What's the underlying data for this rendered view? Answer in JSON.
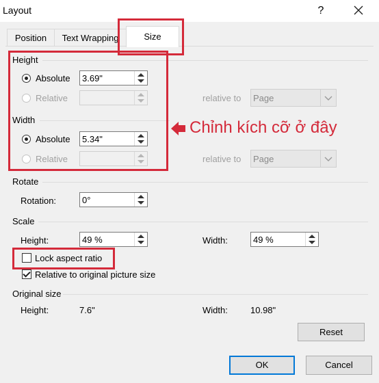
{
  "dialog": {
    "title": "Layout",
    "help_label": "?"
  },
  "tabs": [
    {
      "label": "Position"
    },
    {
      "label": "Text Wrapping"
    },
    {
      "label": "Size"
    }
  ],
  "height": {
    "section_label": "Height",
    "absolute_label": "Absolute",
    "absolute_value": "3.69\"",
    "relative_label": "Relative",
    "relative_to_label": "relative to",
    "relative_to_value": "Page"
  },
  "width": {
    "section_label": "Width",
    "absolute_label": "Absolute",
    "absolute_value": "5.34\"",
    "relative_label": "Relative",
    "relative_to_label": "relative to",
    "relative_to_value": "Page"
  },
  "annotation": {
    "text": "Chỉnh kích cỡ ở đây",
    "color": "#d42a3a"
  },
  "rotate": {
    "section_label": "Rotate",
    "rotation_label": "Rotation:",
    "rotation_value": "0°"
  },
  "scale": {
    "section_label": "Scale",
    "height_label": "Height:",
    "height_value": "49 %",
    "width_label": "Width:",
    "width_value": "49 %",
    "lock_aspect_label": "Lock aspect ratio",
    "lock_aspect_checked": false,
    "relative_original_label": "Relative to original picture size",
    "relative_original_checked": true
  },
  "original_size": {
    "section_label": "Original size",
    "height_label": "Height:",
    "height_value": "7.6\"",
    "width_label": "Width:",
    "width_value": "10.98\""
  },
  "buttons": {
    "reset_label": "Reset",
    "ok_label": "OK",
    "cancel_label": "Cancel"
  },
  "colors": {
    "highlight_red": "#d42a3a",
    "default_button_border": "#0078d7"
  }
}
